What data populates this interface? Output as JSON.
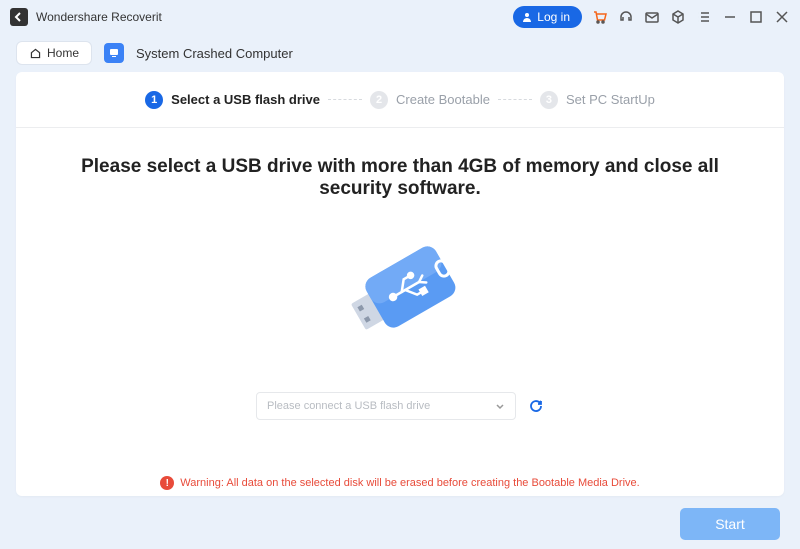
{
  "app": {
    "title": "Wondershare Recoverit"
  },
  "titlebar": {
    "login": "Log in"
  },
  "breadcrumb": {
    "home": "Home",
    "page": "System Crashed Computer"
  },
  "stepper": {
    "steps": [
      {
        "num": "1",
        "label": "Select a USB flash drive"
      },
      {
        "num": "2",
        "label": "Create Bootable"
      },
      {
        "num": "3",
        "label": "Set PC StartUp"
      }
    ]
  },
  "headline": "Please select a USB drive with more than 4GB of memory and close all security software.",
  "drive": {
    "placeholder": "Please connect a USB flash drive"
  },
  "warning": "Warning: All data on the selected disk will be erased before creating the Bootable Media Drive.",
  "footer": {
    "start": "Start"
  }
}
